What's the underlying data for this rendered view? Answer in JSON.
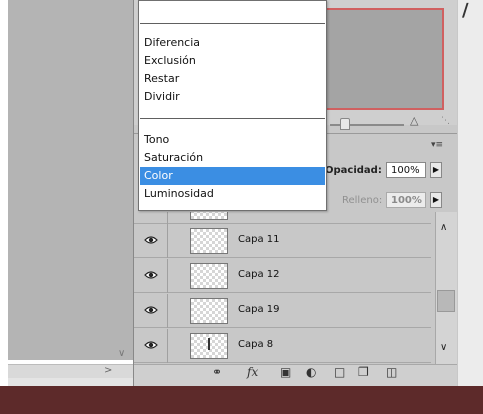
{
  "blend_menu": {
    "group_difference": [
      "Diferencia",
      "Exclusión",
      "Restar",
      "Dividir"
    ],
    "group_component": [
      "Tono",
      "Saturación",
      "Color",
      "Luminosidad"
    ],
    "selected": "Color"
  },
  "layers_panel": {
    "opacity_label": "Opacidad:",
    "opacity_value": "100%",
    "fill_label": "Relleno:",
    "fill_value": "100%",
    "layers": [
      {
        "name": "Capa 11"
      },
      {
        "name": "Capa 12"
      },
      {
        "name": "Capa 19"
      },
      {
        "name": "Capa 8"
      }
    ]
  },
  "footer_icons": [
    "link-icon",
    "fx-icon",
    "mask-icon",
    "adjustment-icon",
    "group-folder-icon",
    "new-layer-icon",
    "trash-icon"
  ],
  "colors": {
    "selection": "#3b8ee3",
    "panel": "#c8c8c8",
    "navigator_frame": "#d06060",
    "bottom_band": "#5d2a2a"
  }
}
